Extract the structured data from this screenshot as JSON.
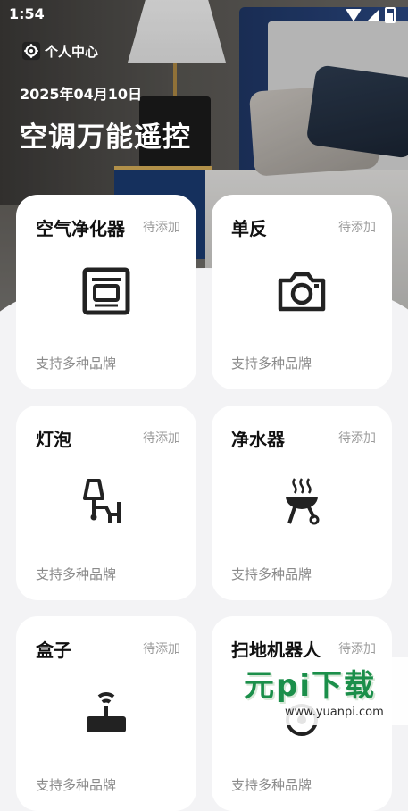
{
  "status_bar": {
    "time": "1:54"
  },
  "header": {
    "profile_label": "个人中心",
    "date": "2025年04月10日",
    "title": "空调万能遥控"
  },
  "devices": [
    {
      "name": "空气净化器",
      "status": "待添加",
      "support": "支持多种品牌",
      "icon": "oven-icon"
    },
    {
      "name": "单反",
      "status": "待添加",
      "support": "支持多种品牌",
      "icon": "camera-icon"
    },
    {
      "name": "灯泡",
      "status": "待添加",
      "support": "支持多种品牌",
      "icon": "floor-lamp-icon"
    },
    {
      "name": "净水器",
      "status": "待添加",
      "support": "支持多种品牌",
      "icon": "grill-icon"
    },
    {
      "name": "盒子",
      "status": "待添加",
      "support": "支持多种品牌",
      "icon": "router-icon"
    },
    {
      "name": "扫地机器人",
      "status": "待添加",
      "support": "支持多种品牌",
      "icon": "robot-vacuum-icon"
    }
  ],
  "watermark": {
    "brand": "元pi下载",
    "url": "www.yuanpi.com"
  }
}
